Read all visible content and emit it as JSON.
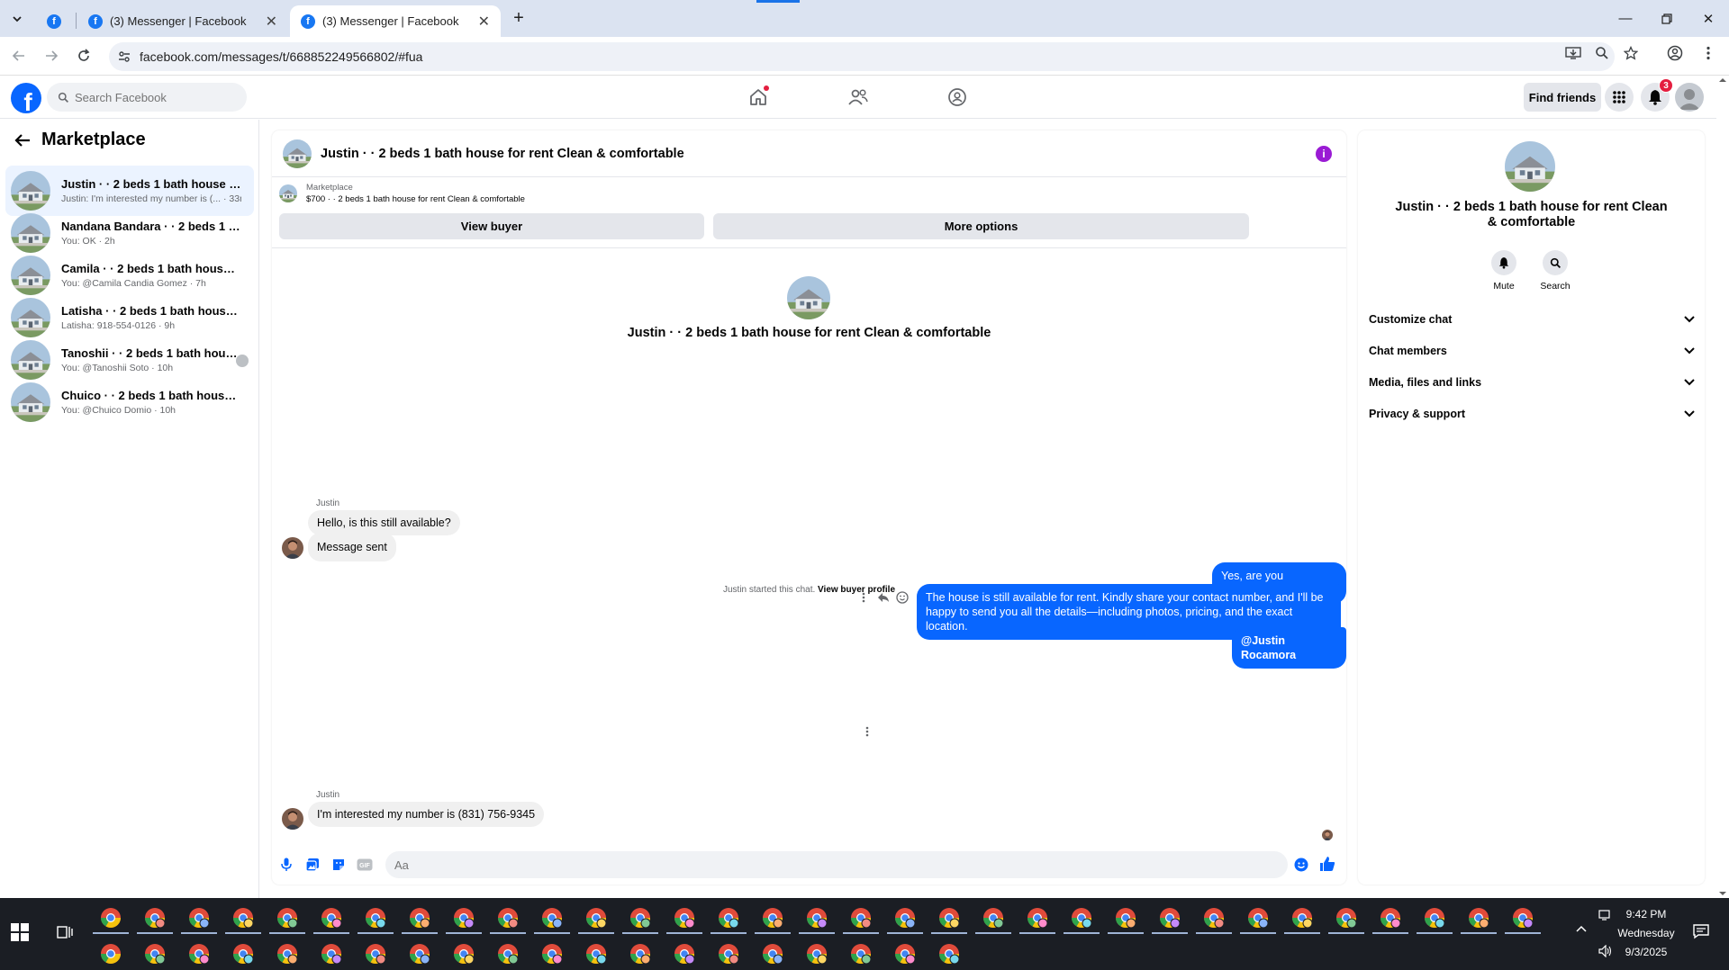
{
  "browser": {
    "tabs": [
      {
        "title": "(3) Messenger | Facebook",
        "active": false
      },
      {
        "title": "(3) Messenger | Facebook",
        "active": true
      }
    ],
    "url": "facebook.com/messages/t/668852249566802/#fua"
  },
  "fb": {
    "search_placeholder": "Search Facebook",
    "find_friends": "Find friends",
    "notif_count": "3"
  },
  "sidebar": {
    "title": "Marketplace",
    "conversations": [
      {
        "name": "Justin · · 2 beds 1 bath house for re...",
        "preview": "Justin: I'm interested my number is (... · 33m",
        "active": true
      },
      {
        "name": "Nandana Bandara · · 2 beds 1 bath ...",
        "preview": "You: OK · 2h",
        "active": false
      },
      {
        "name": "Camila · · 2 beds 1 bath house for r...",
        "preview": "You: @Camila Candia Gomez · 7h",
        "active": false
      },
      {
        "name": "Latisha · · 2 beds 1 bath house for r...",
        "preview": "Latisha: 918-554-0126 · 9h",
        "active": false
      },
      {
        "name": "Tanoshii · · 2 beds 1 bath house f...",
        "preview": "You: @Tanoshii Soto · 10h",
        "active": false
      },
      {
        "name": "Chuico · · 2 beds 1 bath house for r...",
        "preview": "You: @Chuico Domio · 10h",
        "active": false
      }
    ]
  },
  "chat": {
    "title": "Justin · · 2 beds 1 bath house for rent Clean & comfortable",
    "marketplace_label": "Marketplace",
    "listing": "$700 · · 2 beds 1 bath house for rent Clean & comfortable",
    "view_buyer": "View buyer",
    "more_options": "More options",
    "intro_title": "Justin · · 2 beds 1 bath house for rent Clean & comfortable",
    "started_text": "Justin started this chat.",
    "view_buyer_profile": "View buyer profile",
    "messages": {
      "sender1": "Justin",
      "in1": "Hello, is this still available?",
      "in2": "Message sent",
      "out1": "Yes, are you interested?",
      "out2": "The house is still available for rent. Kindly share your contact number, and I'll be happy to send you all the details—including photos, pricing, and the exact location.",
      "out3": "@Justin Rocamora",
      "sender2": "Justin",
      "in3": "I'm interested my number is (831) 756-9345"
    },
    "input_placeholder": "Aa"
  },
  "details": {
    "title": "Justin · · 2 beds 1 bath house for rent Clean & comfortable",
    "mute": "Mute",
    "search": "Search",
    "sections": [
      "Customize chat",
      "Chat members",
      "Media, files and links",
      "Privacy & support"
    ]
  },
  "taskbar": {
    "time": "9:42 PM",
    "day": "Wednesday",
    "date": "9/3/2025"
  },
  "colors": {
    "fb_blue": "#0866ff",
    "info_purple": "#9a1bd4",
    "tab_bar": "#dbe3f1"
  }
}
